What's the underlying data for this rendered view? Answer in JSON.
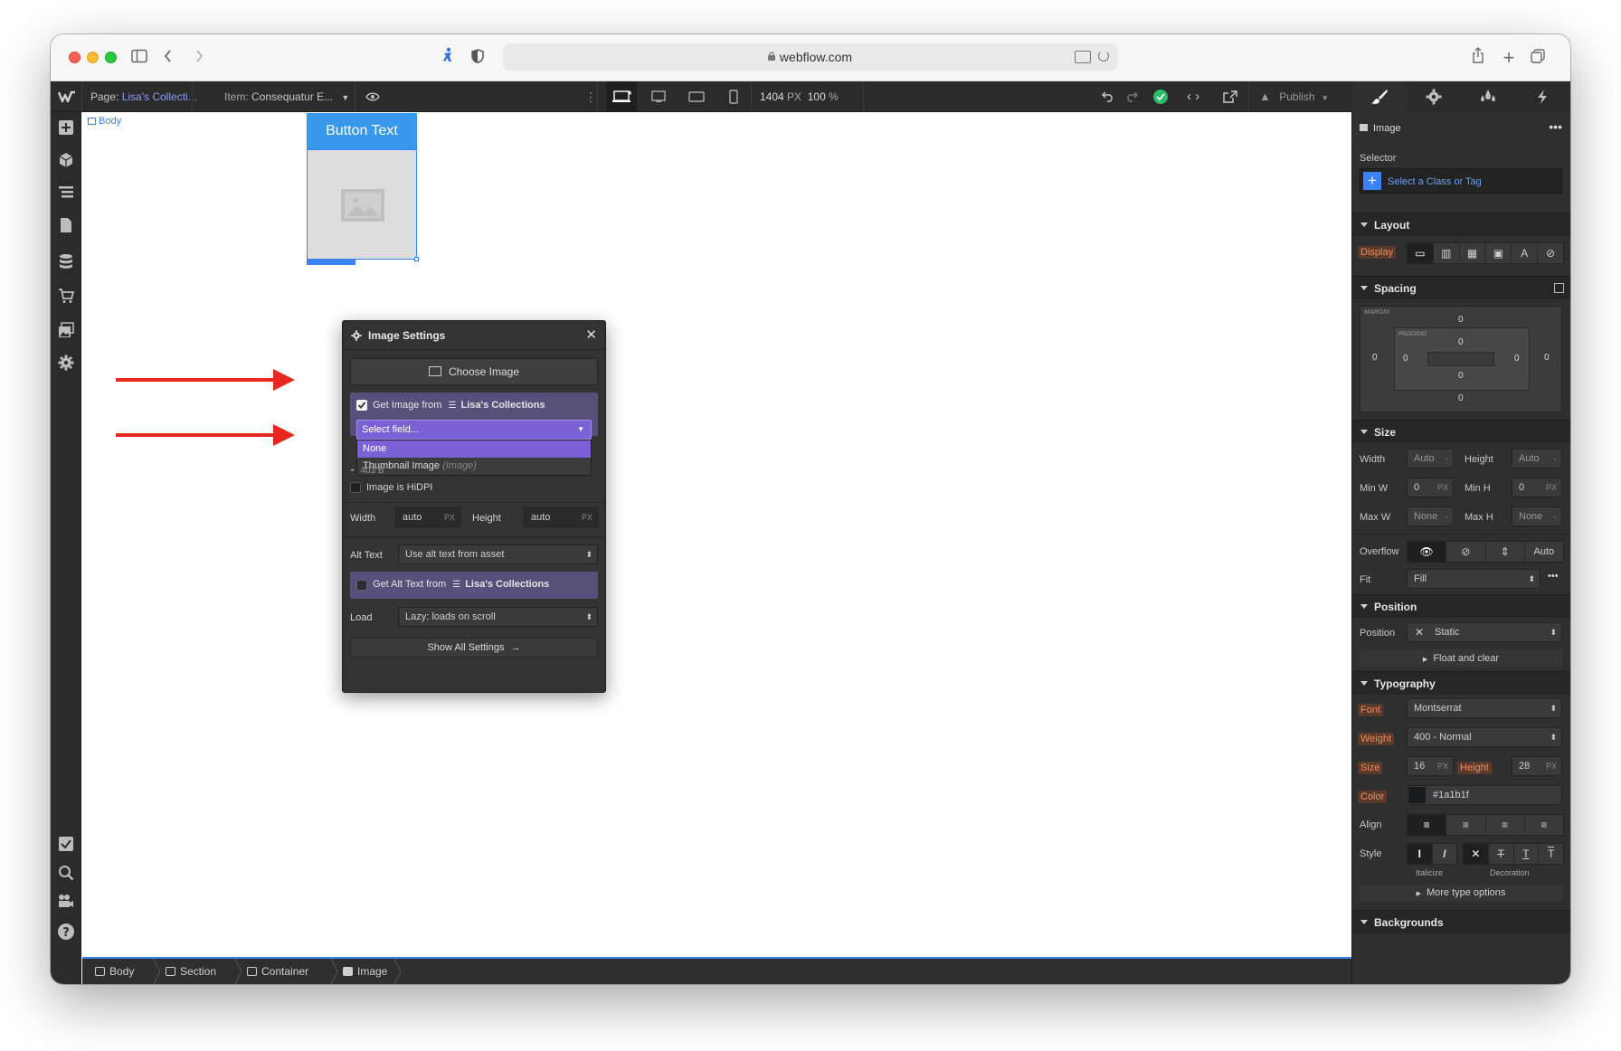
{
  "browser": {
    "url": "webflow.com",
    "colors": {
      "close": "#fe5f57",
      "minimize": "#febc2e",
      "zoom": "#28c840"
    }
  },
  "topbar": {
    "page_label": "Page:",
    "page_value": "Lisa's Collecti...",
    "item_label": "Item:",
    "item_value": "Consequatur E...",
    "width_readout": "1404",
    "width_unit": "PX",
    "zoom_readout": "100",
    "zoom_unit": "%",
    "publish_label": "Publish"
  },
  "canvas": {
    "body_tag": "Body",
    "button_text": "Button Text"
  },
  "image_settings": {
    "title": "Image Settings",
    "choose_image": "Choose Image",
    "get_image_prefix": "Get Image from",
    "collection_name": "Lisa's Collections",
    "select_field_placeholder": "Select field...",
    "options": [
      {
        "label": "None",
        "hint": ""
      },
      {
        "label": "Thumbnail Image",
        "hint": "(Image)"
      }
    ],
    "file_size": "403 B",
    "hidpi_label": "Image is HiDPI",
    "width_label": "Width",
    "width_value": "auto",
    "height_label": "Height",
    "height_value": "auto",
    "unit_px": "PX",
    "alt_text_label": "Alt Text",
    "alt_text_value": "Use alt text from asset",
    "get_alt_prefix": "Get Alt Text from",
    "load_label": "Load",
    "load_value": "Lazy: loads on scroll",
    "show_all": "Show All Settings"
  },
  "style_panel": {
    "element_name": "Image",
    "selector_label": "Selector",
    "selector_placeholder": "Select a Class or Tag",
    "layout": {
      "title": "Layout",
      "display_label": "Display"
    },
    "spacing": {
      "title": "Spacing",
      "margin_label": "MARGIN",
      "padding_label": "PADDING",
      "margin": {
        "top": "0",
        "right": "0",
        "bottom": "0",
        "left": "0"
      },
      "padding": {
        "top": "0",
        "right": "0",
        "bottom": "0",
        "left": "0"
      }
    },
    "size": {
      "title": "Size",
      "width_label": "Width",
      "width_value": "Auto",
      "height_label": "Height",
      "height_value": "Auto",
      "minw_label": "Min W",
      "minw_value": "0",
      "minh_label": "Min H",
      "minh_value": "0",
      "maxw_label": "Max W",
      "maxw_value": "None",
      "maxh_label": "Max H",
      "maxh_value": "None",
      "unit_px": "PX",
      "dash": "-",
      "overflow_label": "Overflow",
      "overflow_auto": "Auto",
      "fit_label": "Fit",
      "fit_value": "Fill"
    },
    "position": {
      "title": "Position",
      "position_label": "Position",
      "position_value": "Static",
      "float_clear": "Float and clear"
    },
    "typography": {
      "title": "Typography",
      "font_label": "Font",
      "font_value": "Montserrat",
      "weight_label": "Weight",
      "weight_value": "400 - Normal",
      "size_label": "Size",
      "size_value": "16",
      "size_unit": "PX",
      "height_label": "Height",
      "height_value": "28",
      "height_unit": "PX",
      "color_label": "Color",
      "color_value": "#1a1b1f",
      "align_label": "Align",
      "style_label": "Style",
      "italicize_label": "Italicize",
      "decoration_label": "Decoration",
      "more_type": "More type options"
    },
    "backgrounds": {
      "title": "Backgrounds"
    }
  },
  "breadcrumbs": [
    "Body",
    "Section",
    "Container",
    "Image"
  ]
}
